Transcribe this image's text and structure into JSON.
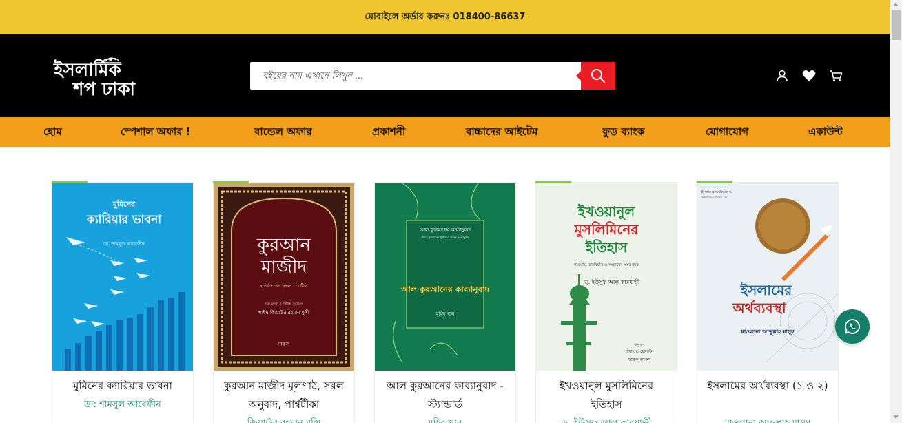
{
  "topbar": {
    "text": "মোবাইলে অর্ডার করুনঃ 018400-86637"
  },
  "header": {
    "logo": {
      "line1": "ইসলামিক",
      "line2": "শপ ঢাকা"
    },
    "search": {
      "placeholder": "বইয়ের নাম এখানে লিখুন ..."
    },
    "icons": [
      "user-icon",
      "heart-icon",
      "cart-icon"
    ]
  },
  "nav": {
    "items": [
      {
        "label": "হোম"
      },
      {
        "label": "স্পেশাল অফার !"
      },
      {
        "label": "বান্ডেল অফার"
      },
      {
        "label": "প্রকাশনী"
      },
      {
        "label": "বাচ্চাদের আইটেম"
      },
      {
        "label": "ফুড ব্যাংক"
      },
      {
        "label": "যোগাযোগ"
      },
      {
        "label": "একাউন্ট"
      }
    ]
  },
  "products": [
    {
      "title": "মুমিনের ক্যারিয়ার ভাবনা",
      "author": "ডা: শামসুল আরেফীন",
      "cover": {
        "small": "মুমিনের",
        "main": "ক্যারিয়ার ভাবনা",
        "author": "ডা. শামসুল আরেফীন",
        "bg": "#17a2dd"
      }
    },
    {
      "title": "কুরআন মাজীদ মূলপাঠ, সরল অনুবাদ, পার্শ্বটীকা",
      "author": "জিয়াউর রহমান মুন্সি",
      "cover": {
        "main1": "কুরআন",
        "main2": "মাজীদ",
        "sub": "মূলপাঠ • সরল অনুবাদ • পার্শ্বটীকা",
        "small": "সরল অনুবাদ ও পার্শ্বটীকা সংযোজন",
        "author": "শাইখ জিয়াউর রহমান মুন্সী",
        "publisher": "দারুল",
        "bg": "#5a0e12"
      }
    },
    {
      "title": "আল কুরআনের কাব্যানুবাদ - স্ট্যান্ডার্ড",
      "author": "মুহিব খান",
      "cover": {
        "top": "আল কুরআনের কাব্যানুবাদ",
        "sub": "পবিত্র কুরআনের পূর্ণাঙ্গ ও বিশুদ্ধ কাব্যানুবাদ",
        "main": "আল কুরআনের কাব্যানুবাদ",
        "author": "মুহিব খান",
        "bg": "#127a4f"
      }
    },
    {
      "title": "ইখওয়ানুল মুসলিমিনের ইতিহাস",
      "author": "ড. ইউসুফ আল কারযাভী",
      "cover": {
        "main1": "ইখওয়ানুল",
        "main2": "মুসলিমিনের",
        "main3": "ইতিহাস",
        "sub": "দাওয়াহ, তারবিয়াত ও সংগ্রামের সত্তর বছর",
        "author": "ড. ইউসুফ আল কারযাভী",
        "translator_label": "অনুবাদ",
        "translator1": "শাহাদাত হোসাইন",
        "translator2": "ফারুক আজম",
        "bg": "#eef3ea"
      }
    },
    {
      "title": "ইসলামের অর্থব্যবস্থা (১ ও ২)",
      "author": "মাওলানা আব্দুল্লাহ মাসুম",
      "cover": {
        "top1": "ইসলামের অর্থব্যবস্থা-১",
        "top2": "অর্থনীতির প্রাথমিক পাঠ",
        "main1": "ইসলামের",
        "main2": "অর্থব্যবস্থা",
        "author": "মাওলানা আব্দুল্লাহ মাসুম",
        "bg": "#eaf0f4"
      }
    }
  ],
  "colors": {
    "topbar": "#efc530",
    "nav": "#f19e1b",
    "search_button": "#ec1c24",
    "author": "#178a73",
    "whatsapp": "#157f6b"
  }
}
